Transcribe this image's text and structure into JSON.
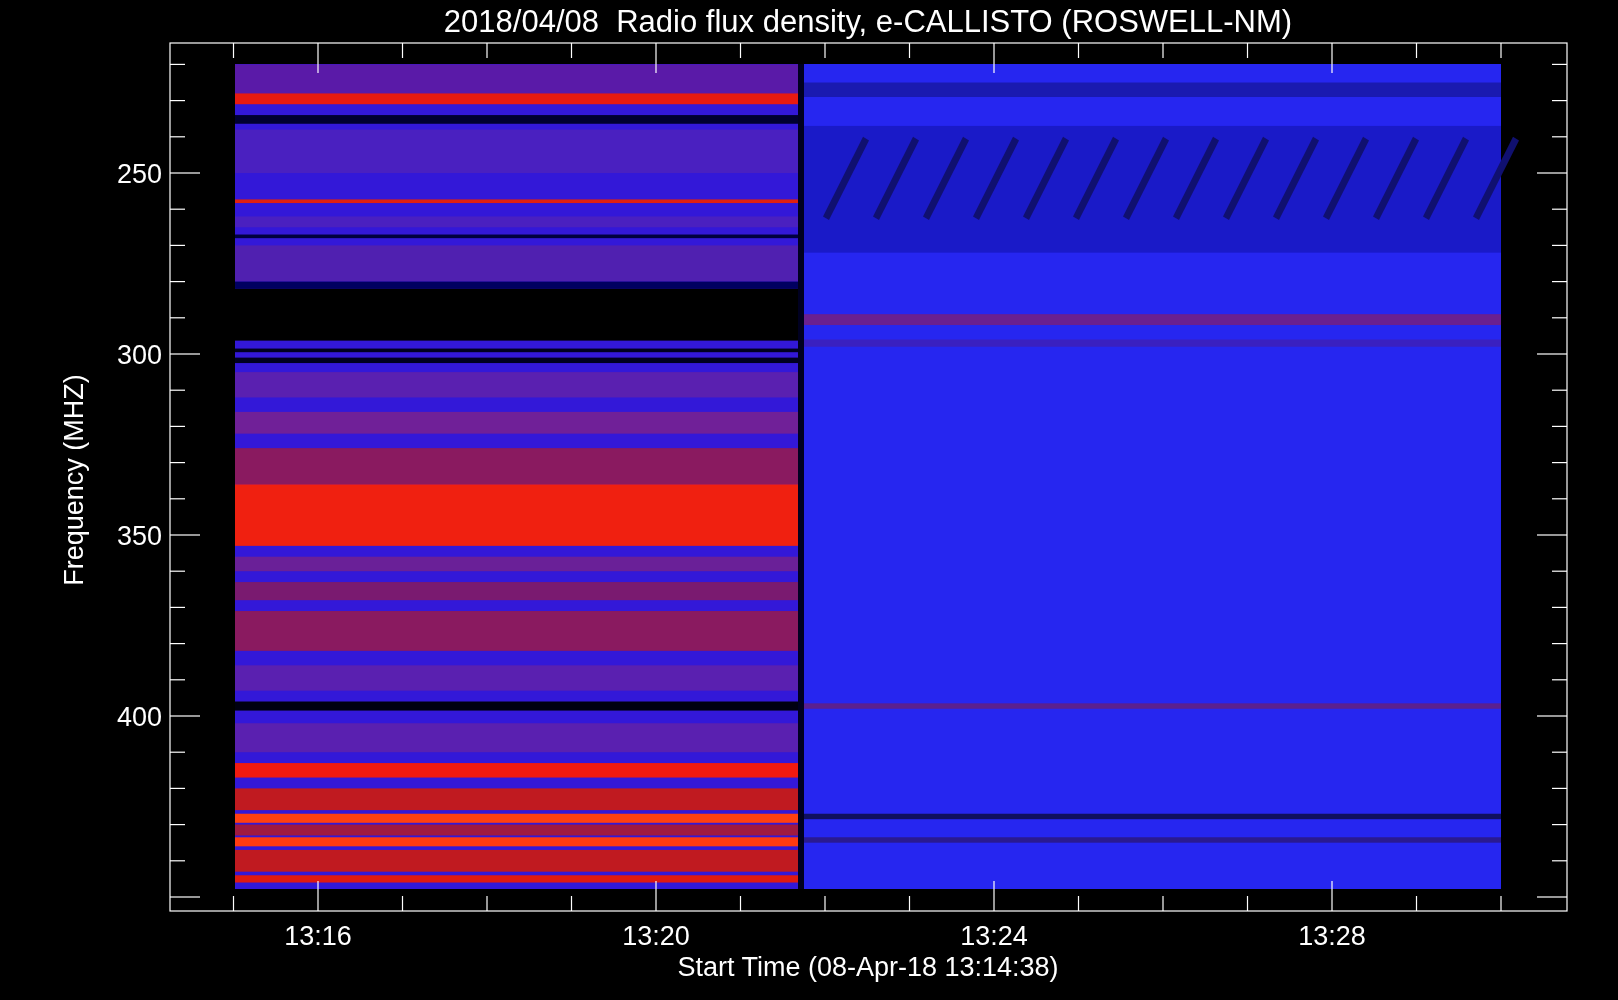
{
  "plot": {
    "title": "2018/04/08  Radio flux density, e-CALLISTO (ROSWELL-NM)",
    "xlabel": "Start Time (08-Apr-18 13:14:38)",
    "ylabel": "Frequency (MHZ)",
    "xticks": [
      "13:16",
      "13:20",
      "13:24",
      "13:28"
    ],
    "yticks": [
      "250",
      "300",
      "350",
      "400"
    ]
  }
}
